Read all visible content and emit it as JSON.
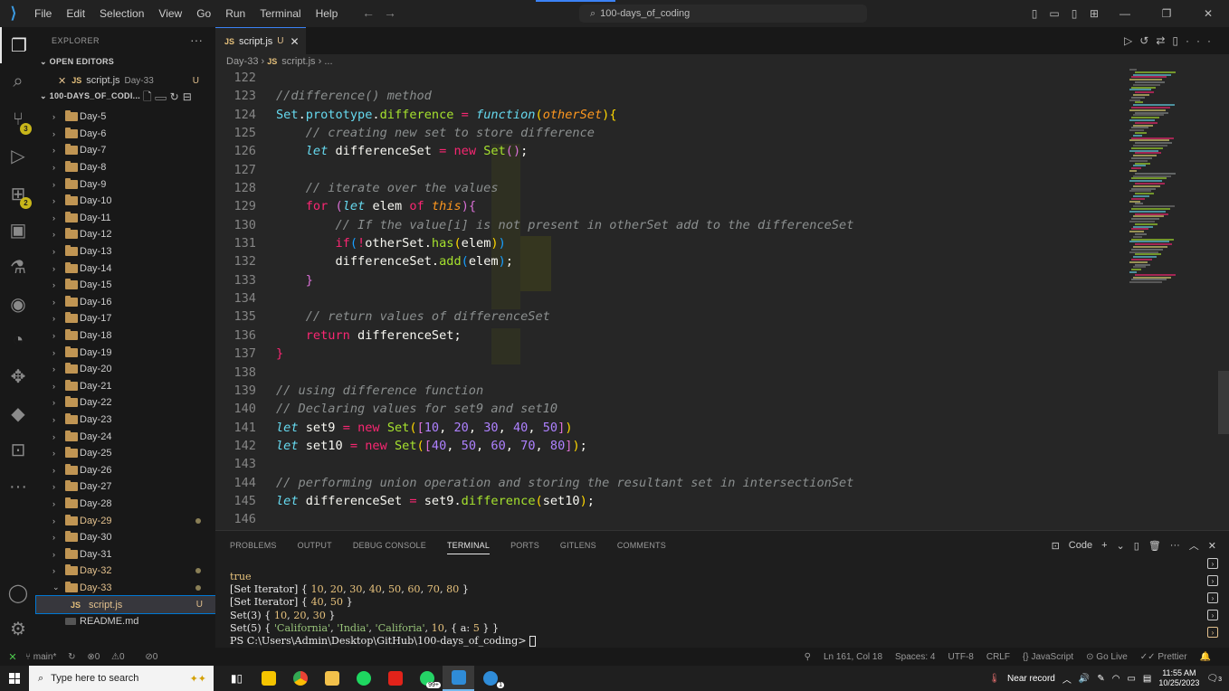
{
  "titlebar": {
    "menu": [
      "File",
      "Edit",
      "Selection",
      "View",
      "Go",
      "Run",
      "Terminal",
      "Help"
    ],
    "search": "100-days_of_coding",
    "accent": "#3b82f6"
  },
  "sidebar": {
    "title": "EXPLORER",
    "open_editors": "OPEN EDITORS",
    "open_file": {
      "name": "script.js",
      "folder": "Day-33",
      "status": "U"
    },
    "project": "100-DAYS_OF_CODI...",
    "folders": [
      "Day-5",
      "Day-6",
      "Day-7",
      "Day-8",
      "Day-9",
      "Day-10",
      "Day-11",
      "Day-12",
      "Day-13",
      "Day-14",
      "Day-15",
      "Day-16",
      "Day-17",
      "Day-18",
      "Day-19",
      "Day-20",
      "Day-21",
      "Day-22",
      "Day-23",
      "Day-24",
      "Day-25",
      "Day-26",
      "Day-27",
      "Day-28",
      "Day-29",
      "Day-30",
      "Day-31",
      "Day-32",
      "Day-33"
    ],
    "modified": [
      "Day-29",
      "Day-32",
      "Day-33"
    ],
    "child_file": {
      "name": "script.js",
      "status": "U"
    },
    "readme": "README.md"
  },
  "activity": {
    "scm_badge": "3",
    "ext_badge": "2",
    "icons": [
      "files-icon",
      "search-icon",
      "source-control-icon",
      "run-debug-icon",
      "extensions-icon",
      "remote-explorer-icon",
      "testing-icon",
      "github-icon",
      "timeline-icon",
      "figma-icon",
      "terraform-icon",
      "terminal-icon",
      "more-icon",
      "account-icon",
      "settings-icon"
    ]
  },
  "editor": {
    "tab": {
      "label": "script.js",
      "status": "U",
      "lang": "JS"
    },
    "breadcrumb": {
      "folder": "Day-33",
      "file": "script.js",
      "tail": "..."
    },
    "line_numbers": [
      "122",
      "123",
      "124",
      "125",
      "126",
      "127",
      "128",
      "129",
      "130",
      "131",
      "132",
      "133",
      "134",
      "135",
      "136",
      "137",
      "138",
      "139",
      "140",
      "141",
      "142",
      "143",
      "144",
      "145",
      "146"
    ]
  },
  "panel": {
    "tabs": [
      "PROBLEMS",
      "OUTPUT",
      "DEBUG CONSOLE",
      "TERMINAL",
      "PORTS",
      "GITLENS",
      "COMMENTS"
    ],
    "active_tab": "TERMINAL",
    "shell_label": "Code",
    "terminal_lines": {
      "l1": "true",
      "prompt": "PS C:\\Users\\Admin\\Desktop\\GitHub\\100-days_of_coding> "
    }
  },
  "statusbar": {
    "branch": "main*",
    "errors": "0",
    "warnings": "0",
    "ports": "0",
    "position": "Ln 161, Col 18",
    "spaces": "Spaces: 4",
    "encoding": "UTF-8",
    "eol": "CRLF",
    "language": "JavaScript",
    "golive": "Go Live",
    "prettier": "Prettier"
  },
  "taskbar": {
    "search_placeholder": "Type here to search",
    "whatsapp_badge": "99+",
    "mail_badge": "1",
    "weather": "Near record",
    "time": "11:55 AM",
    "date": "10/25/2023",
    "notif": "3"
  }
}
